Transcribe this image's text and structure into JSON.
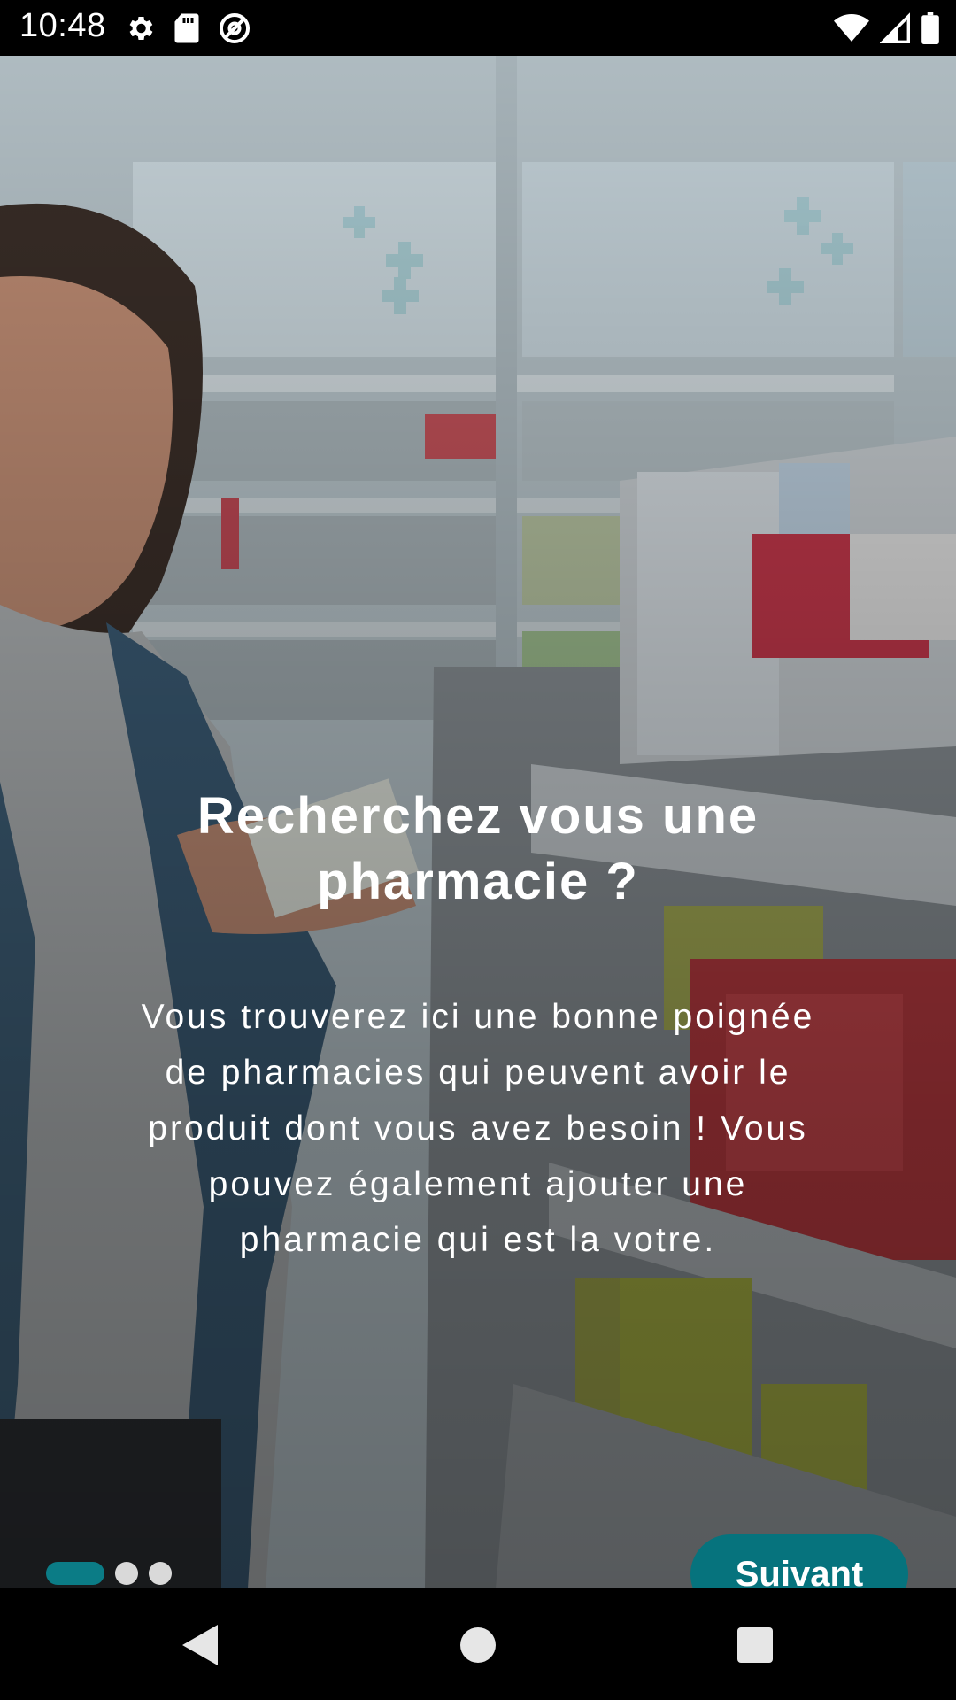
{
  "status_bar": {
    "time": "10:48",
    "left_icons": [
      "settings-icon",
      "sd-card-icon",
      "vpn-icon"
    ],
    "right_icons": [
      "wifi-icon",
      "cellular-signal-icon",
      "battery-icon"
    ]
  },
  "onboarding": {
    "title_line1": "Recherchez vous une",
    "title_line2": "pharmacie ?",
    "description_lines": [
      "Vous trouverez ici une bonne poignée",
      "de pharmacies qui peuvent avoir le",
      "produit dont vous avez besoin ! Vous",
      "pouvez également ajouter une",
      "pharmacie qui est la votre."
    ],
    "page_count": 3,
    "current_page": 1,
    "next_label": "Suivant"
  },
  "colors": {
    "accent": "#06737d",
    "indicator_active": "#0b7c86",
    "indicator_inactive": "#d9d9d9"
  },
  "nav_bar": {
    "buttons": [
      "back-icon",
      "home-icon",
      "recents-icon"
    ]
  }
}
